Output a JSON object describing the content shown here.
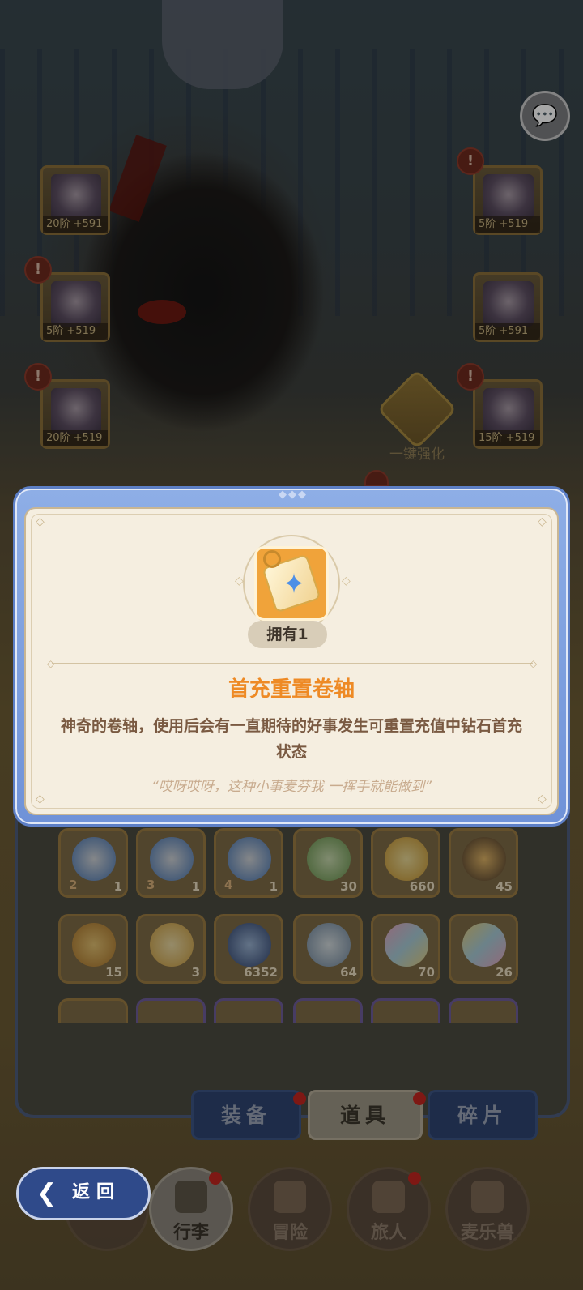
{
  "equipment": {
    "slots": [
      {
        "id": "left-1",
        "level": "20阶 +591",
        "warn": false
      },
      {
        "id": "left-2",
        "level": "5阶 +519",
        "warn": true
      },
      {
        "id": "left-3",
        "level": "20阶 +519",
        "warn": true
      },
      {
        "id": "right-1",
        "level": "5阶 +519",
        "warn": true
      },
      {
        "id": "right-2",
        "level": "5阶 +591",
        "warn": false
      },
      {
        "id": "right-3",
        "level": "15阶 +519",
        "warn": true
      }
    ],
    "warn_glyph": "!",
    "enhance_label": "一键强化"
  },
  "chat": {
    "icon": "chat-bubbles-icon",
    "glyph": "💬"
  },
  "modal": {
    "owned_label": "拥有1",
    "item_name": "首充重置卷轴",
    "description": "神奇的卷轴，使用后会有一直期待的好事发生可重置充值中钻石首充状态",
    "quote": "“哎呀哎呀，这种小事麦芬我 一挥手就能做到”",
    "ornament": "◆◆◆",
    "item_icon": "scroll-star-icon",
    "accent_color": "#ee8a25"
  },
  "inventory": {
    "row1": [
      {
        "rank": "2",
        "count": "1",
        "icon": "balloon-icon"
      },
      {
        "rank": "3",
        "count": "1",
        "icon": "balloon-icon"
      },
      {
        "rank": "4",
        "count": "1",
        "icon": "balloon-icon"
      },
      {
        "rank": "",
        "count": "30",
        "icon": "paper-plane-icon"
      },
      {
        "rank": "",
        "count": "660",
        "icon": "star-icon"
      },
      {
        "rank": "",
        "count": "45",
        "icon": "bell-icon"
      }
    ],
    "row2": [
      {
        "rank": "",
        "count": "15",
        "icon": "coin-icon"
      },
      {
        "rank": "",
        "count": "3",
        "icon": "lyre-icon"
      },
      {
        "rank": "",
        "count": "6352",
        "icon": "egg-icon"
      },
      {
        "rank": "",
        "count": "64",
        "icon": "crystal-icon"
      },
      {
        "rank": "",
        "count": "70",
        "icon": "paint-tube-icon"
      },
      {
        "rank": "",
        "count": "26",
        "icon": "paint-tube-icon"
      }
    ]
  },
  "tabs": {
    "equip": "装备",
    "items": "道具",
    "fragments": "碎片"
  },
  "nav": {
    "back": "返回",
    "bag": "行李",
    "adventure": "冒险",
    "traveler": "旅人",
    "pet": "麦乐兽"
  }
}
